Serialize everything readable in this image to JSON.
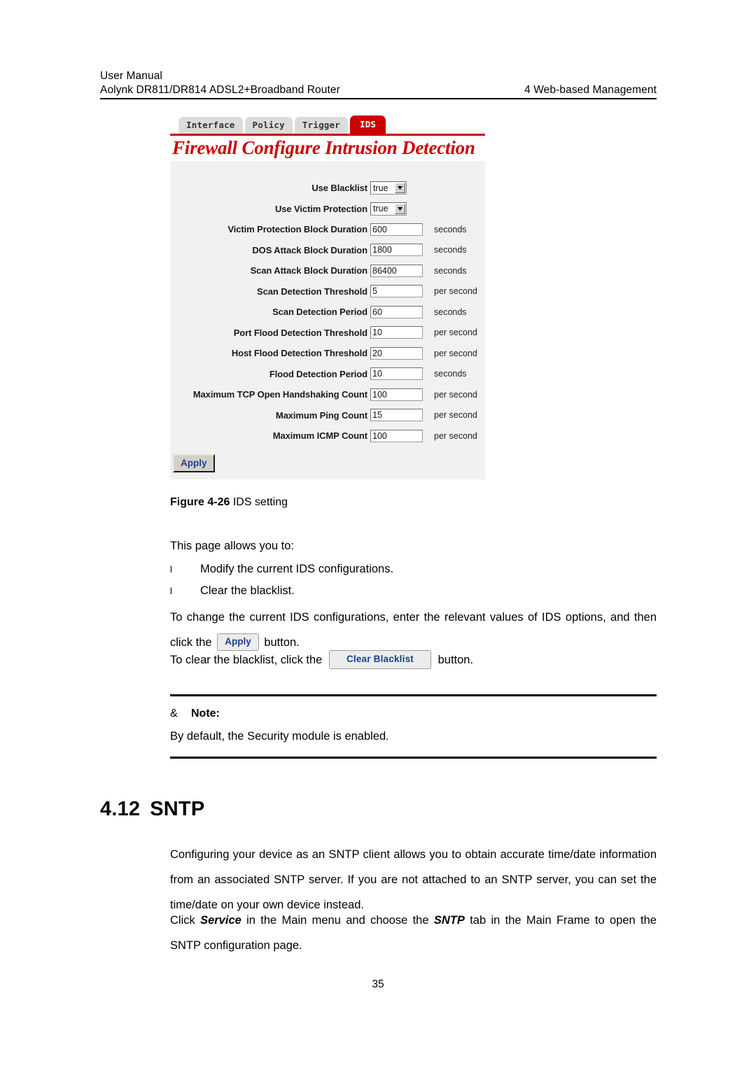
{
  "header": {
    "line1": "User Manual",
    "line2_left": "Aolynk DR811/DR814 ADSL2+Broadband Router",
    "line2_right": "4  Web-based Management"
  },
  "screenshot": {
    "tabs": [
      {
        "label": "Interface",
        "active": false
      },
      {
        "label": "Policy",
        "active": false
      },
      {
        "label": "Trigger",
        "active": false
      },
      {
        "label": "IDS",
        "active": true
      }
    ],
    "title": "Firewall Configure Intrusion Detection",
    "accent_color": "#cc0000",
    "panel_background": "#f1f1f1",
    "fields": [
      {
        "label": "Use Blacklist",
        "type": "select",
        "value": "true",
        "unit": ""
      },
      {
        "label": "Use Victim Protection",
        "type": "select",
        "value": "true",
        "unit": ""
      },
      {
        "label": "Victim Protection Block Duration",
        "type": "text",
        "value": "600",
        "unit": "seconds"
      },
      {
        "label": "DOS Attack Block Duration",
        "type": "text",
        "value": "1800",
        "unit": "seconds"
      },
      {
        "label": "Scan Attack Block Duration",
        "type": "text",
        "value": "86400",
        "unit": "seconds"
      },
      {
        "label": "Scan Detection Threshold",
        "type": "text",
        "value": "5",
        "unit": "per second"
      },
      {
        "label": "Scan Detection Period",
        "type": "text",
        "value": "60",
        "unit": "seconds"
      },
      {
        "label": "Port Flood Detection Threshold",
        "type": "text",
        "value": "10",
        "unit": "per second"
      },
      {
        "label": "Host Flood Detection Threshold",
        "type": "text",
        "value": "20",
        "unit": "per second"
      },
      {
        "label": "Flood Detection Period",
        "type": "text",
        "value": "10",
        "unit": "seconds"
      },
      {
        "label": "Maximum TCP Open Handshaking Count",
        "type": "text",
        "value": "100",
        "unit": "per second"
      },
      {
        "label": "Maximum Ping Count",
        "type": "text",
        "value": "15",
        "unit": "per second"
      },
      {
        "label": "Maximum ICMP Count",
        "type": "text",
        "value": "100",
        "unit": "per second"
      }
    ],
    "apply_button": "Apply"
  },
  "figure": {
    "number": "Figure 4-26",
    "caption": "IDS setting"
  },
  "body": {
    "intro": "This page allows you to:",
    "bullet_marker": "l",
    "bullets": [
      "Modify the current IDS configurations.",
      "Clear the blacklist."
    ],
    "para_change_part1": "To change the current IDS configurations, enter the relevant values of IDS options, and then click the",
    "para_change_button": "Apply",
    "para_change_part2": "button.",
    "para_clear_part1": "To clear the blacklist, click the",
    "para_clear_button": "Clear Blacklist",
    "para_clear_part2": "button."
  },
  "note": {
    "symbol": "&",
    "title": "Note:",
    "text": "By default, the Security module is enabled."
  },
  "section": {
    "number": "4.12",
    "title": "SNTP",
    "para1": "Configuring your device as an SNTP client allows you to obtain accurate time/date information from an associated SNTP server. If you are not attached to an SNTP server, you can set the time/date on your own device instead.",
    "para2_part1": "Click",
    "para2_em1": "Service",
    "para2_part2": "in the Main menu and choose the",
    "para2_em2": "SNTP",
    "para2_part3": "tab in the Main Frame to open the SNTP configuration page."
  },
  "page_number": "35"
}
